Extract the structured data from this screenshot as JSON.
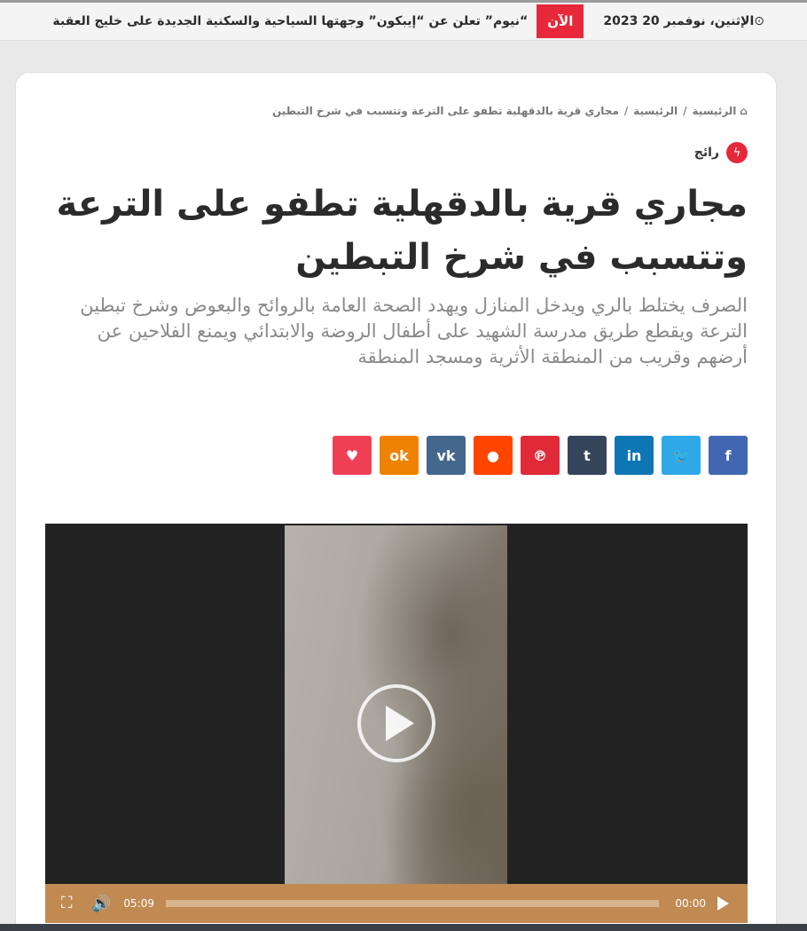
{
  "topbar": {
    "clock_icon": "clock-icon",
    "date": "الإثنين، نوفمبر 20 2023",
    "now_label": "الآن",
    "ticker_text": "“نيوم” تعلن عن “إيبكون” وجهتها السياحية والسكنية الجديدة على خليج العقبة"
  },
  "breadcrumb": {
    "home_icon": "home-icon",
    "items": [
      "الرئيسية",
      "الرئيسية",
      "مجاري قرية بالدقهلية تطفو على الترعة وتتسبب في شرخ التبطين"
    ],
    "separator": "/"
  },
  "badge": {
    "icon": "bolt-icon",
    "label": "رائج"
  },
  "article": {
    "title": "مجاري قرية بالدقهلية تطفو على الترعة وتتسبب في شرخ التبطين",
    "subtitle": "الصرف يختلط بالري ويدخل المنازل ويهدد الصحة العامة بالروائح والبعوض وشرخ تبطين الترعة ويقطع طريق مدرسة الشهيد على أطفال الروضة والابتدائي ويمنع الفلاحين عن أرضهم وقريب من المنطقة الأثرية ومسجد المنطقة"
  },
  "share": [
    {
      "name": "facebook",
      "glyph": "f",
      "color": "#4267b2"
    },
    {
      "name": "twitter",
      "glyph": "🐦",
      "color": "#2fa8e8"
    },
    {
      "name": "linkedin",
      "glyph": "in",
      "color": "#0f76b4"
    },
    {
      "name": "tumblr",
      "glyph": "t",
      "color": "#35465c"
    },
    {
      "name": "pinterest",
      "glyph": "℗",
      "color": "#e02a38"
    },
    {
      "name": "reddit",
      "glyph": "●",
      "color": "#ff4500"
    },
    {
      "name": "vk",
      "glyph": "vk",
      "color": "#44678d"
    },
    {
      "name": "odnoklassniki",
      "glyph": "ok",
      "color": "#ef8200"
    },
    {
      "name": "pocket",
      "glyph": "♥",
      "color": "#ef4056"
    }
  ],
  "video": {
    "current_time": "05:09",
    "duration": "00:00",
    "progress": 0
  }
}
